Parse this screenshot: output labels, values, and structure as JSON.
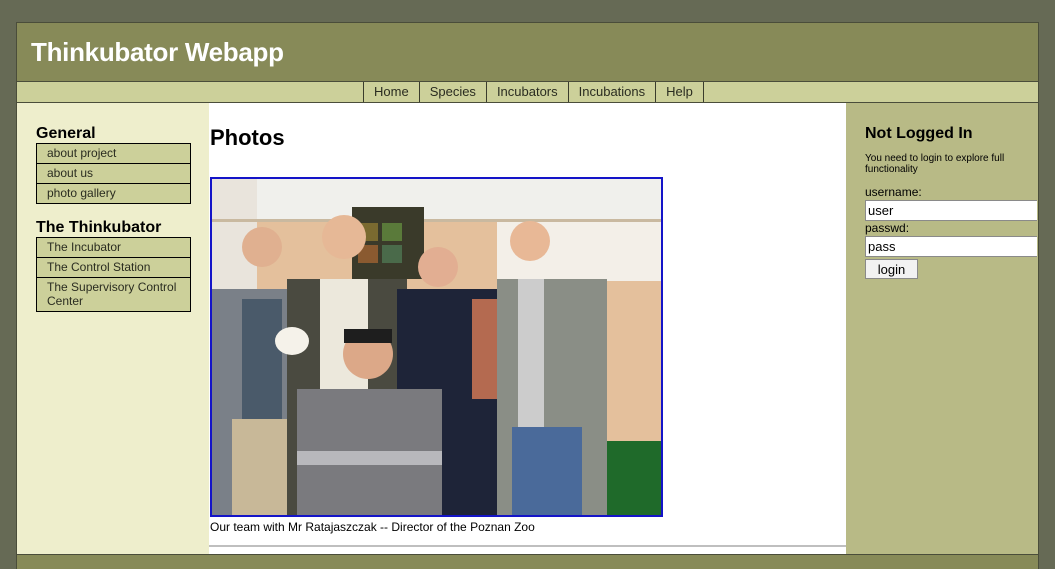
{
  "header": {
    "title": "Thinkubator Webapp"
  },
  "nav": {
    "items": [
      {
        "label": "Home"
      },
      {
        "label": "Species"
      },
      {
        "label": "Incubators"
      },
      {
        "label": "Incubations"
      },
      {
        "label": "Help"
      }
    ]
  },
  "sidebar": {
    "general": {
      "title": "General",
      "items": [
        {
          "label": "about project"
        },
        {
          "label": "about us"
        },
        {
          "label": "photo gallery"
        }
      ]
    },
    "thinkubator": {
      "title": "The Thinkubator",
      "items": [
        {
          "label": "The Incubator"
        },
        {
          "label": "The Control Station"
        },
        {
          "label": "The Supervisory Control Center"
        }
      ]
    }
  },
  "main": {
    "heading": "Photos",
    "caption": "Our team with Mr Ratajaszczak -- Director of the Poznan Zoo"
  },
  "login": {
    "title": "Not Logged In",
    "note": "You need to login to explore full functionality",
    "username_label": "username:",
    "username_value": "user",
    "password_label": "passwd:",
    "password_value": "pass",
    "button_label": "login"
  },
  "colors": {
    "page_bg": "#666a55",
    "header_bg": "#878a58",
    "nav_bg": "#ccd09a",
    "left_bg": "#eeeecc",
    "right_bg": "#b8ba86",
    "photo_border": "#1414c8"
  }
}
